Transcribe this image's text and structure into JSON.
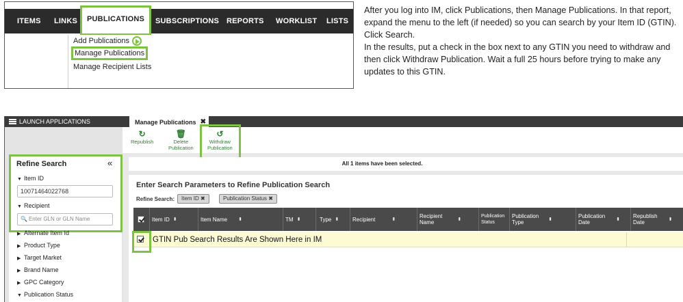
{
  "menu": {
    "items": [
      "ITEMS",
      "LINKS",
      "PUBLICATIONS",
      "SUBSCRIPTIONS",
      "REPORTS",
      "WORKLIST",
      "LISTS"
    ],
    "active": "PUBLICATIONS",
    "dropdown": [
      "Add Publications",
      "Manage Publications",
      "Manage Recipient Lists"
    ]
  },
  "instructions": {
    "para1": "After you log into IM, click Publications, then Manage Publications.  In that report, expand the menu to the left (if needed) so you can search by your Item ID (GTIN).  Click Search.",
    "para2": "In the results, put a check in the box next to any GTIN you need to withdraw and then click Withdraw Publication.  Wait a full 25 hours before trying to make any updates to this GTIN."
  },
  "app": {
    "launch_label": "LAUNCH APPLICATIONS",
    "tab_label": "Manage Publications",
    "toolbar": {
      "republish": "Republish",
      "delete_l1": "Delete",
      "delete_l2": "Publication",
      "withdraw_l1": "Withdraw",
      "withdraw_l2": "Publication"
    },
    "refine": {
      "title": "Refine Search",
      "item_id_label": "Item ID",
      "item_id_value": "10071464022768",
      "recipient_label": "Recipient",
      "recipient_placeholder": "Enter GLN or GLN Name",
      "facets": [
        "Alternate Item Id",
        "Product Type",
        "Target Market",
        "Brand Name",
        "GPC Category"
      ],
      "publication_status_label": "Publication Status"
    },
    "selected_message": "All 1 items have been selected.",
    "params_title": "Enter Search Parameters to Refine Publication Search",
    "refine_search_label": "Refine Search:",
    "chips": [
      "Item ID",
      "Publication Status"
    ],
    "columns": {
      "item_id": "Item ID",
      "item_name": "Item Name",
      "tm": "TM",
      "type": "Type",
      "recipient": "Recipient",
      "recipient_name_l1": "Recipient",
      "recipient_name_l2": "Name",
      "pub_status_l1": "Publication",
      "pub_status_l2": "Status",
      "pub_type_l1": "Publication",
      "pub_type_l2": "Type",
      "pub_date_l1": "Publication",
      "pub_date_l2": "Date",
      "republish_date_l1": "Republish",
      "republish_date_l2": "Date"
    },
    "row_text": "GTIN Pub Search Results Are Shown  Here in IM"
  },
  "colors": {
    "highlight": "#7dc242",
    "menu_bar": "#2b2b2b",
    "grid_header": "#4a4a4a",
    "row_selected": "#fdfbd4",
    "action_green": "#2e7d32"
  }
}
